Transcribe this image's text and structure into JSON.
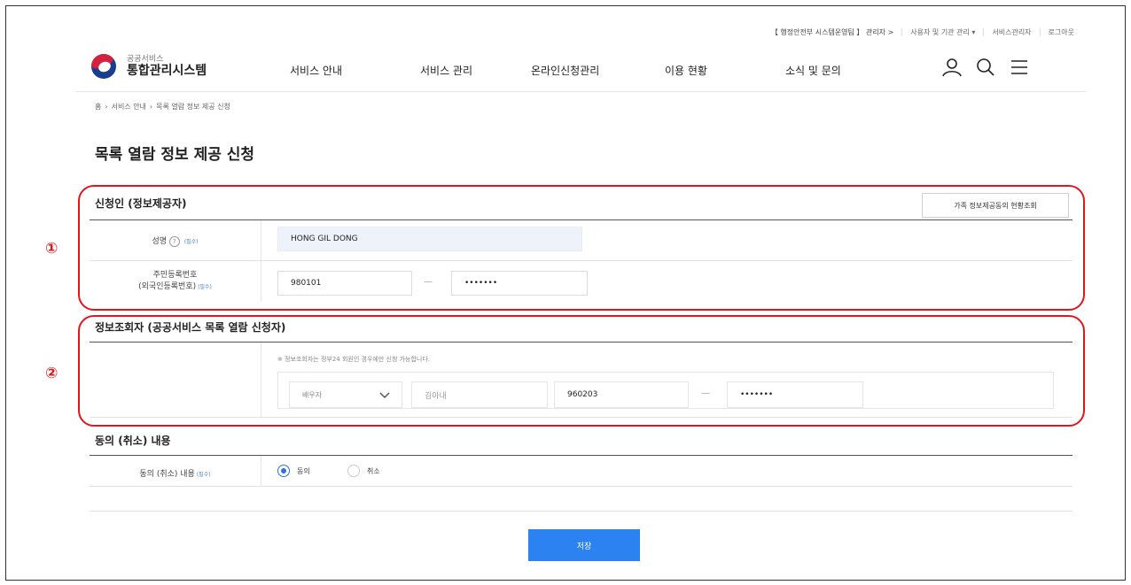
{
  "util_bar": {
    "org": "【 행정안전부 시스템운영팀 】 관리자 >",
    "users_menu": "사용자 및 기관 관리 ▾",
    "service_admin": "서비스관리자",
    "logout": "로그아웃"
  },
  "logo": {
    "sub": "공공서비스",
    "main": "통합관리시스템"
  },
  "gnb": [
    "서비스 안내",
    "서비스 관리",
    "온라인신청관리",
    "이용 현황",
    "소식 및 문의"
  ],
  "icons": {
    "user": "user-icon",
    "search": "search-icon",
    "menu": "hamburger-menu-icon"
  },
  "breadcrumb": [
    "홈",
    "서비스 안내",
    "목록 열람 정보 제공 신청"
  ],
  "page_title": "목록 열람 정보 제공 신청",
  "applicant": {
    "title": "신청인 (정보제공자)",
    "family_button": "가족 정보제공동의 현황조회",
    "name_label": "성명",
    "required": "(필수)",
    "name_value": "HONG GIL DONG",
    "rrn_label_1": "주민등록번호",
    "rrn_label_2": "(외국인등록번호)",
    "rrn_front": "980101",
    "rrn_back": "•••••••",
    "dash": "—"
  },
  "viewer": {
    "title": "정보조회자 (공공서비스 목록 열람 신청자)",
    "note": "※ 정보조회자는 정부24 회원인 경우에만 신청 가능합니다.",
    "relation": "배우자",
    "name_placeholder": "김아내",
    "rrn_front": "960203",
    "rrn_back": "•••••••",
    "dash": "—"
  },
  "consent": {
    "title": "동의 (취소) 내용",
    "label": "동의 (취소) 내용",
    "required": "(필수)",
    "options": [
      "동의",
      "취소"
    ],
    "selected": "동의"
  },
  "save_button": "저장",
  "annotations": [
    "①",
    "②"
  ],
  "colors": {
    "accent": "#2b82f0",
    "annotation": "#e0161e",
    "required": "#4b82d6"
  }
}
